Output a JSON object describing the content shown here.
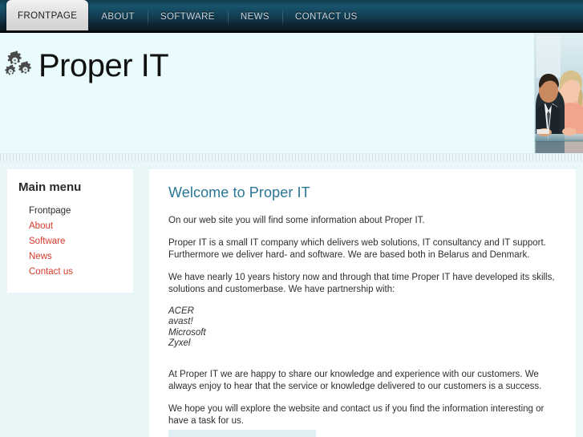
{
  "nav": {
    "items": [
      {
        "label": "FRONTPAGE",
        "active": true
      },
      {
        "label": "ABOUT",
        "active": false
      },
      {
        "label": "SOFTWARE",
        "active": false
      },
      {
        "label": "NEWS",
        "active": false
      },
      {
        "label": "CONTACT US",
        "active": false
      }
    ]
  },
  "header": {
    "logo_text": "Proper IT",
    "logo_icon": "gears-icon",
    "photo_alt": "business-team-photo"
  },
  "sidebar": {
    "title": "Main menu",
    "items": [
      {
        "label": "Frontpage",
        "current": true
      },
      {
        "label": "About",
        "current": false
      },
      {
        "label": "Software",
        "current": false
      },
      {
        "label": "News",
        "current": false
      },
      {
        "label": "Contact us",
        "current": false
      }
    ]
  },
  "main": {
    "title": "Welcome to Proper IT",
    "paragraph_1": "On our web site you will find some information about Proper IT.",
    "paragraph_2": "Proper IT is a small IT company which delivers web solutions, IT consultancy and IT support. Furthermore we deliver hard- and software. We are based both in Belarus and Denmark.",
    "paragraph_3": "We have nearly 10 years history now and through that time Proper IT have developed its skills, solutions and customerbase. We have partnership with:",
    "partners": [
      "ACER",
      "avast!",
      "Microsoft",
      "Zyxel"
    ],
    "paragraph_4": "At Proper IT we are happy to share our knowledge and experience with our customers. We always enjoy to hear that the service or knowledge delivered to our customers is a success.",
    "paragraph_5": "We hope you will explore the website and contact us if you find the information interesting or have a task for us."
  },
  "colors": {
    "nav_dark": "#123d52",
    "header_bg": "#e9fbfc",
    "accent_link": "#d8392b",
    "heading": "#2a7795",
    "page_bg": "#f2fcfc"
  }
}
